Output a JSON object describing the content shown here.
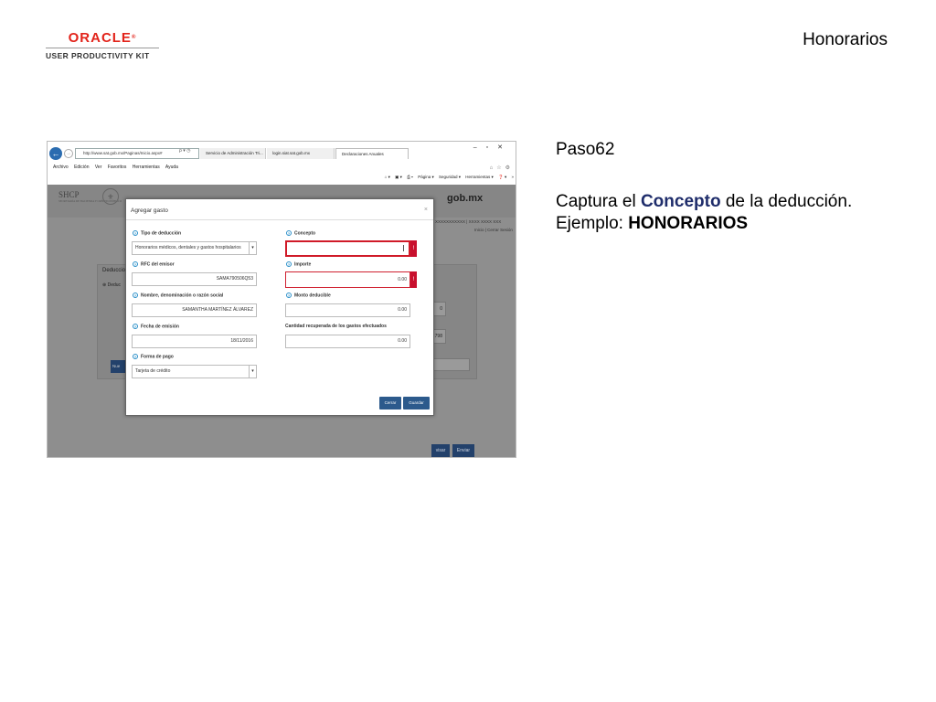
{
  "header": {
    "logo_brand": "ORACLE",
    "logo_reg": "®",
    "logo_tagline": "USER PRODUCTIVITY KIT",
    "page_title": "Honorarios"
  },
  "instructions": {
    "step": "Paso62",
    "line1_pre": "Captura el ",
    "line1_highlight": "Concepto",
    "line1_post": " de la deducción.",
    "line2_pre": "Ejemplo: ",
    "line2_example": "HONORARIOS"
  },
  "browser": {
    "back_glyph": "←",
    "forward_glyph": "→",
    "address": "http://www.sat.gob.mx/Paginas/Inicio.aspx#",
    "address_tools": "ρ ▾ ◷",
    "tabs": [
      "Servicio de Administración Tri...",
      "login.siat.sat.gob.mx",
      "Declaraciones Anuales"
    ],
    "window_controls": "–▫✕",
    "fav_icons": "⌂☆⚙",
    "menu": [
      "Archivo",
      "Edición",
      "Ver",
      "Favoritos",
      "Herramientas",
      "Ayuda"
    ],
    "toolbar": [
      "⌂ ▾",
      "▣ ▾",
      "⎙ ▾",
      "Página ▾",
      "Seguridad ▾",
      "Herramientas ▾",
      "❓ ▾",
      "»"
    ]
  },
  "site": {
    "shcp": "SHCP",
    "shcp_sub": "SECRETARÍA DE HACIENDA Y CRÉDITO PÚBLICO",
    "seal_glyph": "⚜",
    "gob": "gob.mx",
    "rfc_line": "XXXXXXXXXXX | XXXX XXXX XXX",
    "session_line": "Inicio | Cerrar Sesión",
    "panel_title": "Deduccio",
    "panel_sub": "⊕ Deduc",
    "field_values": [
      "0",
      "798"
    ],
    "panel_btn": "Nue",
    "bottom_buttons": [
      "visar",
      "Enviar"
    ]
  },
  "modal": {
    "title": "Agregar gasto",
    "close": "×",
    "help_glyph": "?",
    "caret_glyph": "▾",
    "error_glyph": "!",
    "labels": {
      "tipo": "Tipo de deducción",
      "concepto": "Concepto",
      "rfc": "RFC del emisor",
      "importe": "Importe",
      "nombre": "Nombre, denominación o razón social",
      "monto": "Monto deducible",
      "fecha": "Fecha de emisión",
      "cantidad": "Cantidad recuperada de los gastos efectuados",
      "forma": "Forma de pago"
    },
    "values": {
      "tipo": "Honorarios médicos, dentales y gastos hospitalarios",
      "concepto": "",
      "rfc": "SAMA790506Q53",
      "importe": "0.00",
      "nombre": "SAMANTHA MARTÍNEZ ÁLVAREZ",
      "monto": "0.00",
      "fecha": "18/11/2016",
      "cantidad": "0.00",
      "forma": "Tarjeta de crédito"
    },
    "buttons": {
      "cancel": "Cerrar",
      "save": "Guardar"
    }
  },
  "colors": {
    "oracle_red": "#e2231a",
    "highlight_blue": "#1f2d6b",
    "error_red": "#c8102e",
    "button_blue": "#2c5a8c"
  }
}
